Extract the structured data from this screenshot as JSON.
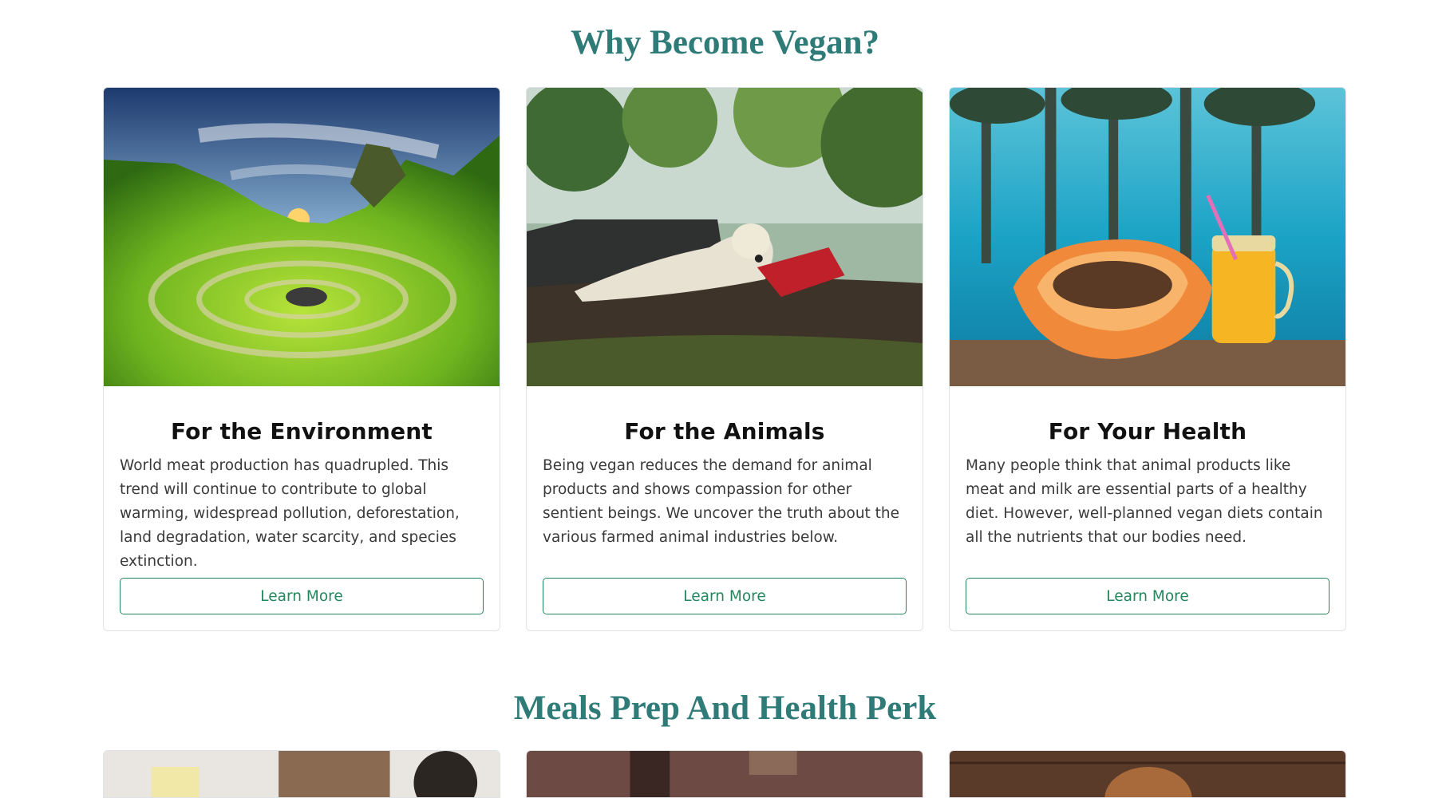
{
  "sections": {
    "why_title": "Why Become Vegan?",
    "meals_title": "Meals Prep And Health Perk"
  },
  "cards": [
    {
      "title": "For the Environment",
      "text": "World meat production has quadrupled. This trend will continue to contribute to global warming, widespread pollution, deforestation, land degradation, water scarcity, and species extinction.",
      "button": "Learn More",
      "image": "environment-landscape-image"
    },
    {
      "title": "For the Animals",
      "text": "Being vegan reduces the demand for animal products and shows compassion for other sentient beings. We uncover the truth about the various farmed animal industries below.",
      "button": "Learn More",
      "image": "polar-bear-image"
    },
    {
      "title": "For Your Health",
      "text": "Many people think that animal products like meat and milk are essential parts of a healthy diet. However, well-planned vegan diets contain all the nutrients that our bodies need.",
      "button": "Learn More",
      "image": "papaya-juice-image"
    }
  ],
  "colors": {
    "heading": "#2e7b78",
    "button": "#23875d"
  }
}
